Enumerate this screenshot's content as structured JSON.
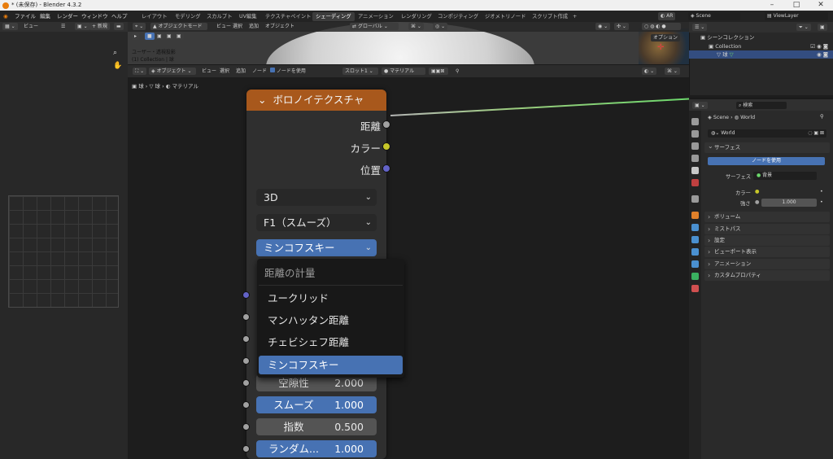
{
  "window": {
    "title": "* (未保存) - Blender 4.3.2"
  },
  "menubar": {
    "menus": [
      "ファイル",
      "編集",
      "レンダー",
      "ウィンドウ",
      "ヘルプ"
    ],
    "workspaces": [
      "レイアウト",
      "モデリング",
      "スカルプト",
      "UV編集",
      "テクスチャペイント",
      "シェーディング",
      "アニメーション",
      "レンダリング",
      "コンポジティング",
      "ジオメトリノード",
      "スクリプト作成"
    ],
    "active_workspace": "シェーディング",
    "add_tab": "+",
    "scene": "Scene",
    "view_layer": "ViewLayer",
    "ar": "AR"
  },
  "left_editor": {
    "view_menu": "ビュー",
    "new_button": "+ 新規"
  },
  "viewport": {
    "mode": "オブジェクトモード",
    "menus": [
      "ビュー",
      "選択",
      "追加",
      "オブジェクト"
    ],
    "orientation": "グローバル",
    "options": "オプション",
    "view_info": "ユーザー・透視投影",
    "collection_info": "(1) Collection | 球"
  },
  "node_editor": {
    "object_type": "オブジェクト",
    "menus": [
      "ビュー",
      "選択",
      "追加",
      "ノード"
    ],
    "use_nodes_label": "ノードを使用",
    "slot": "スロット1",
    "material": "マテリアル",
    "breadcrumb": [
      "球",
      "球",
      "マテリアル"
    ]
  },
  "node": {
    "title": "ボロノイテクスチャ",
    "outputs": [
      "距離",
      "カラー",
      "位置"
    ],
    "dimensions": "3D",
    "feature": "F1（スムーズ）",
    "metric": "ミンコフスキー",
    "fields": [
      {
        "label": "空隙性",
        "value": "2.000"
      },
      {
        "label": "スムーズ",
        "value": "1.000"
      },
      {
        "label": "指数",
        "value": "0.500"
      },
      {
        "label": "ランダム...",
        "value": "1.000"
      }
    ]
  },
  "metric_menu": {
    "title": "距離の計量",
    "items": [
      "ユークリッド",
      "マンハッタン距離",
      "チェビシェフ距離",
      "ミンコフスキー"
    ],
    "active": "ミンコフスキー"
  },
  "outliner": {
    "root": "シーンコレクション",
    "collection": "Collection",
    "object": "球"
  },
  "properties": {
    "search_placeholder": "検索",
    "breadcrumb_scene": "Scene",
    "breadcrumb_world": "World",
    "world_name": "World",
    "surface_section": "サーフェス",
    "use_nodes_button": "ノードを使用",
    "surface_label": "サーフェス",
    "surface_value": "背景",
    "color_label": "カラー",
    "strength_label": "強さ",
    "strength_value": "1.000",
    "sections": [
      "ボリューム",
      "ミストパス",
      "設定",
      "ビューポート表示",
      "アニメーション",
      "カスタムプロパティ"
    ]
  }
}
